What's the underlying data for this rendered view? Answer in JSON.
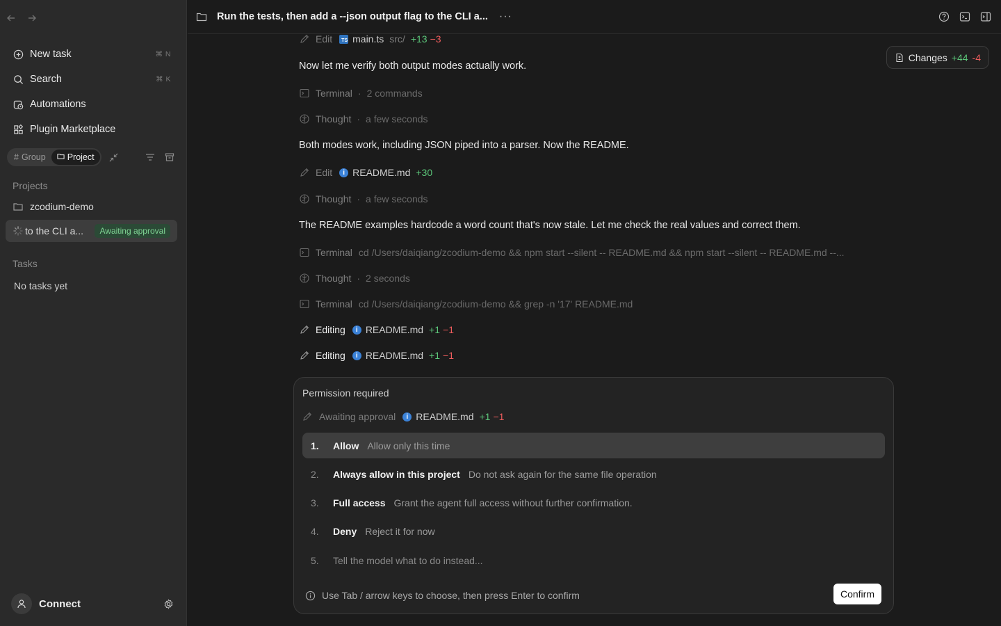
{
  "sidebar": {
    "menu": [
      {
        "label": "New task",
        "shortcut": "⌘ N"
      },
      {
        "label": "Search",
        "shortcut": "⌘ K"
      },
      {
        "label": "Automations",
        "shortcut": ""
      },
      {
        "label": "Plugin Marketplace",
        "shortcut": ""
      }
    ],
    "group_toggle": {
      "group": "Group",
      "project": "Project"
    },
    "projects_label": "Projects",
    "project_name": "zcodium-demo",
    "task": {
      "title": "to the CLI a...",
      "badge": "Awaiting approval"
    },
    "tasks_label": "Tasks",
    "tasks_empty": "No tasks yet",
    "footer": {
      "connect": "Connect"
    }
  },
  "topbar": {
    "title": "Run the tests, then add a --json output flag to the CLI a...",
    "more": "···"
  },
  "changes": {
    "label": "Changes",
    "added": "+44",
    "removed": "-4"
  },
  "log": {
    "edit1": {
      "action": "Edit",
      "file": "main.ts",
      "path": "src/",
      "added": "+13",
      "removed": "−3"
    },
    "msg1": "Now let me verify both output modes actually work.",
    "terminal1": {
      "label": "Terminal",
      "detail": "2 commands"
    },
    "thought1": {
      "label": "Thought",
      "detail": "a few seconds"
    },
    "msg2": "Both modes work, including JSON piped into a parser. Now the README.",
    "edit2": {
      "action": "Edit",
      "file": "README.md",
      "added": "+30"
    },
    "thought2": {
      "label": "Thought",
      "detail": "a few seconds"
    },
    "msg3": "The README examples hardcode a word count that's now stale. Let me check the real values and correct them.",
    "terminal2": {
      "label": "Terminal",
      "detail": "cd /Users/daiqiang/zcodium-demo && npm start --silent -- README.md && npm start --silent -- README.md --..."
    },
    "thought3": {
      "label": "Thought",
      "detail": "2 seconds"
    },
    "terminal3": {
      "label": "Terminal",
      "detail": "cd /Users/daiqiang/zcodium-demo && grep -n '17' README.md"
    },
    "editing1": {
      "action": "Editing",
      "file": "README.md",
      "added": "+1",
      "removed": "−1"
    },
    "editing2": {
      "action": "Editing",
      "file": "README.md",
      "added": "+1",
      "removed": "−1"
    }
  },
  "permission": {
    "title": "Permission required",
    "status": "Awaiting approval",
    "file": "README.md",
    "added": "+1",
    "removed": "−1",
    "options": [
      {
        "num": "1.",
        "label": "Allow",
        "desc": "Allow only this time"
      },
      {
        "num": "2.",
        "label": "Always allow in this project",
        "desc": "Do not ask again for the same file operation"
      },
      {
        "num": "3.",
        "label": "Full access",
        "desc": "Grant the agent full access without further confirmation."
      },
      {
        "num": "4.",
        "label": "Deny",
        "desc": "Reject it for now"
      },
      {
        "num": "5.",
        "placeholder": "Tell the model what to do instead..."
      }
    ],
    "hint": "Use Tab / arrow keys to choose, then press Enter to confirm",
    "confirm": "Confirm"
  }
}
